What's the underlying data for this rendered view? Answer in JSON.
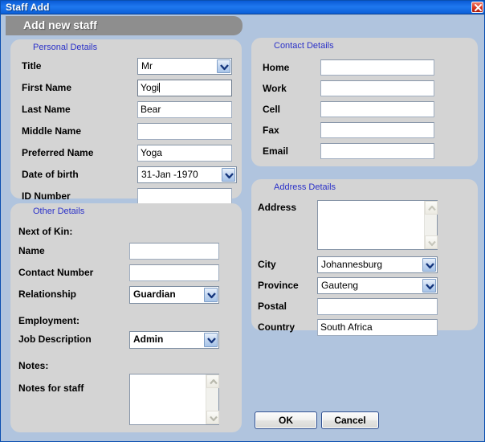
{
  "window": {
    "title": "Staff Add",
    "close_icon": "close-icon",
    "banner_title": "Add new staff",
    "accent_titlebar": "#1f78ef",
    "background": "#b0c4de",
    "panel_background": "#d4d4d4",
    "legend_color": "#2b31c8",
    "banner_background": "#8e8e8e"
  },
  "personal_details": {
    "legend": "Personal Details",
    "title": {
      "label": "Title",
      "value": "Mr",
      "type": "combo"
    },
    "first_name": {
      "label": "First Name",
      "value": "Yogi",
      "type": "text",
      "focused": true
    },
    "last_name": {
      "label": "Last Name",
      "value": "Bear",
      "type": "text"
    },
    "middle_name": {
      "label": "Middle Name",
      "value": "",
      "type": "text"
    },
    "preferred_name": {
      "label": "Preferred Name",
      "value": "Yoga",
      "type": "text"
    },
    "date_of_birth": {
      "label": "Date of birth",
      "value": "31-Jan -1970",
      "type": "combo"
    },
    "id_number": {
      "label": "ID Number",
      "value": "",
      "type": "text"
    }
  },
  "other_details": {
    "legend": "Other Details",
    "next_of_kin_heading": "Next of Kin:",
    "name": {
      "label": "Name",
      "value": "",
      "type": "text"
    },
    "contact_number": {
      "label": "Contact Number",
      "value": "",
      "type": "text"
    },
    "relationship": {
      "label": "Relationship",
      "value": "Guardian",
      "type": "combo"
    },
    "employment_heading": "Employment:",
    "job_description": {
      "label": "Job Description",
      "value": "Admin",
      "type": "combo"
    },
    "notes_heading": "Notes:",
    "notes": {
      "label": "Notes for staff",
      "value": "",
      "type": "textarea"
    }
  },
  "contact_details": {
    "legend": "Contact Details",
    "home": {
      "label": "Home",
      "value": "",
      "type": "text"
    },
    "work": {
      "label": "Work",
      "value": "",
      "type": "text"
    },
    "cell": {
      "label": "Cell",
      "value": "",
      "type": "text"
    },
    "fax": {
      "label": "Fax",
      "value": "",
      "type": "text"
    },
    "email": {
      "label": "Email",
      "value": "",
      "type": "text"
    }
  },
  "address_details": {
    "legend": "Address Details",
    "address": {
      "label": "Address",
      "value": "",
      "type": "textarea"
    },
    "city": {
      "label": "City",
      "value": "Johannesburg",
      "type": "combo"
    },
    "province": {
      "label": "Province",
      "value": "Gauteng",
      "type": "combo"
    },
    "postal": {
      "label": "Postal",
      "value": "",
      "type": "text"
    },
    "country": {
      "label": "Country",
      "value": "South Africa",
      "type": "text"
    }
  },
  "actions": {
    "ok_label": "OK",
    "cancel_label": "Cancel"
  }
}
